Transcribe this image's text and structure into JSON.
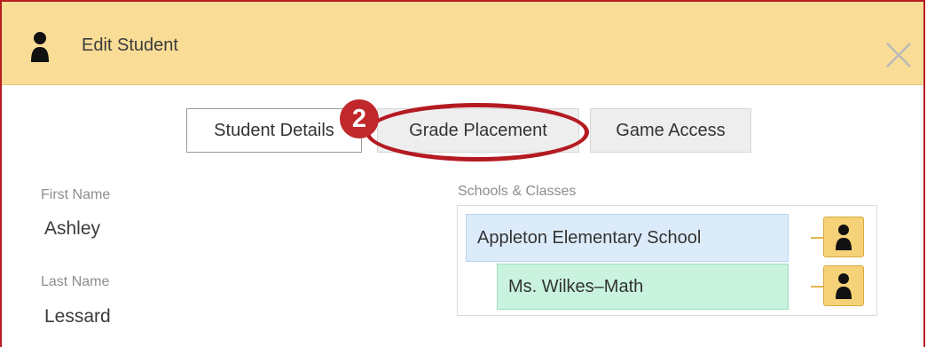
{
  "dialog": {
    "title": "Edit Student",
    "close_glyph": "×"
  },
  "tabs": [
    {
      "label": "Student Details",
      "active": true
    },
    {
      "label": "Grade Placement",
      "active": false
    },
    {
      "label": "Game Access",
      "active": false
    }
  ],
  "annotation": {
    "step_number": "2",
    "color": "#c0282b"
  },
  "student": {
    "first_name_label": "First Name",
    "first_name": "Ashley",
    "last_name_label": "Last Name",
    "last_name": "Lessard"
  },
  "schools": {
    "label": "Schools & Classes",
    "school": "Appleton Elementary School",
    "class": "Ms. Wilkes–Math"
  },
  "colors": {
    "header_bg": "#f9dd97",
    "frame_border": "#b81c22",
    "school_bg": "#dcebfa",
    "class_bg": "#c9f3df",
    "person_button_bg": "#f5d277"
  },
  "icons": {
    "header": "person-icon",
    "close": "close-icon",
    "row_action": "person-icon"
  }
}
